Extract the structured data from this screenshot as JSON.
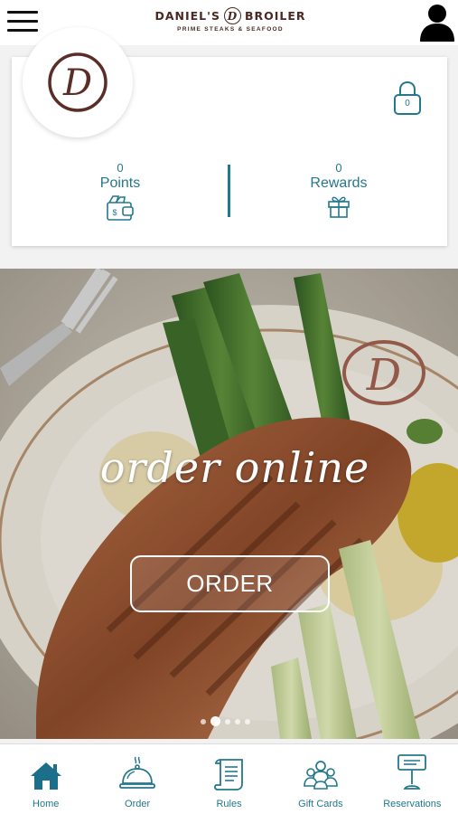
{
  "header": {
    "brand_name_left": "DANIEL'S",
    "brand_monogram": "D",
    "brand_name_right": "BROILER",
    "brand_tagline": "PRIME STEAKS & SEAFOOD"
  },
  "card": {
    "logo_monogram": "D",
    "lock_count": "0",
    "points": {
      "value": "0",
      "label": "Points",
      "icon": "wallet-dollar-icon"
    },
    "rewards": {
      "value": "0",
      "label": "Rewards",
      "icon": "gift-icon"
    }
  },
  "banner": {
    "headline": "order online",
    "button_label": "ORDER",
    "slide_count": 5,
    "active_slide": 2
  },
  "tabs": [
    {
      "label": "Home",
      "icon": "home-icon",
      "active": true
    },
    {
      "label": "Order",
      "icon": "cloche-icon"
    },
    {
      "label": "Rules",
      "icon": "scroll-icon"
    },
    {
      "label": "Gift Cards",
      "icon": "people-group-icon"
    },
    {
      "label": "Reservations",
      "icon": "reservation-sign-icon"
    }
  ],
  "colors": {
    "accent": "#24788c",
    "brand_brown": "#4a2a22",
    "active_tab": "#1c6f8a"
  }
}
